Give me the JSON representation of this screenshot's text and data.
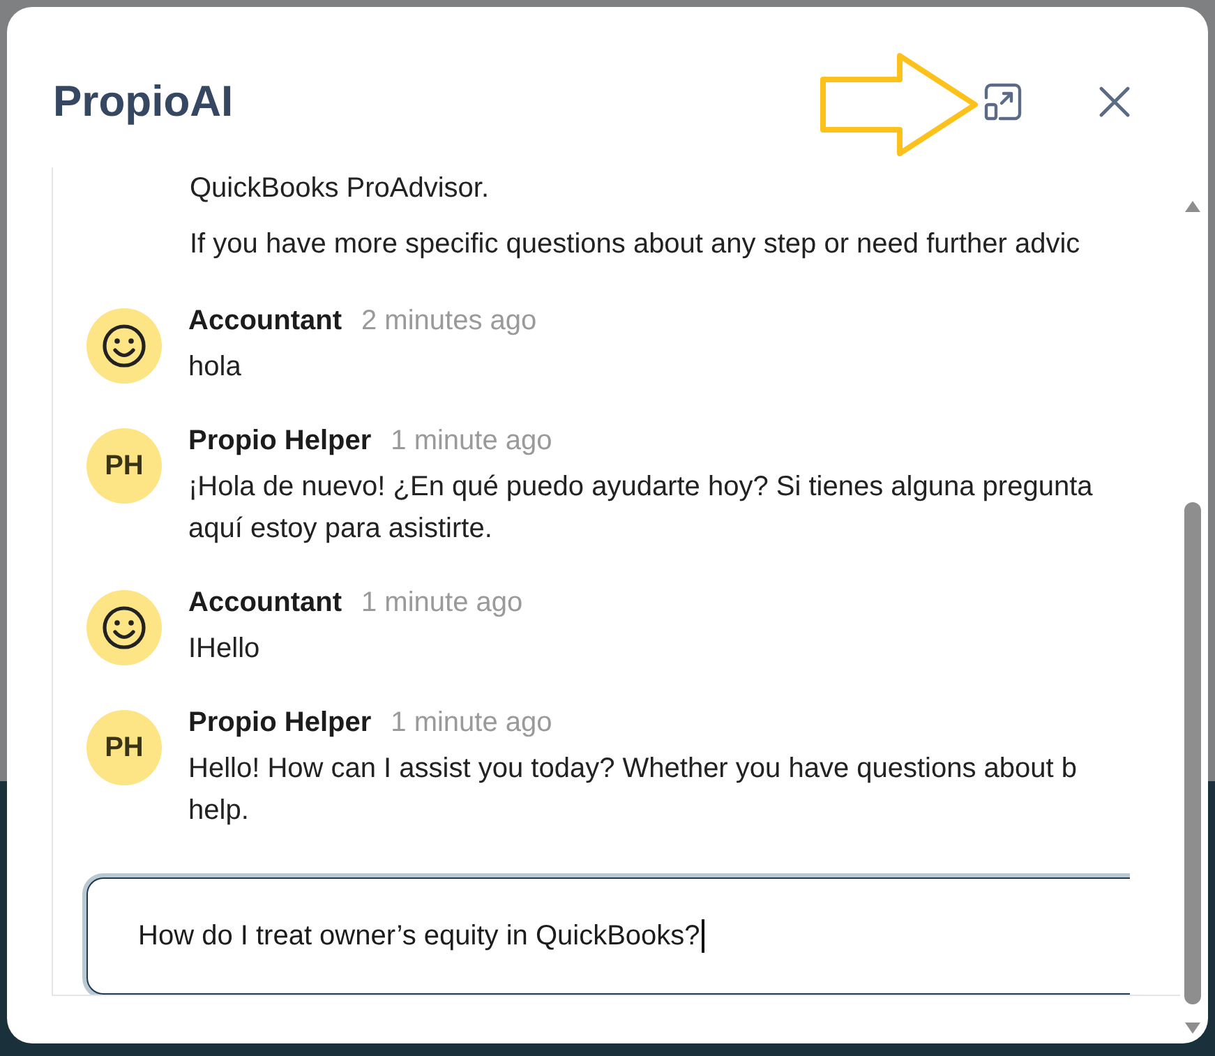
{
  "dialog": {
    "title": "PropioAI"
  },
  "chat": {
    "messages": [
      {
        "kind": "continued",
        "paragraphs": [
          "QuickBooks ProAdvisor.",
          "If you have more specific questions about any step or need further advic"
        ]
      },
      {
        "kind": "message",
        "author": "Accountant",
        "time": "2 minutes ago",
        "avatar": {
          "kind": "smiley"
        },
        "lines": [
          "hola"
        ]
      },
      {
        "kind": "message",
        "author": "Propio Helper",
        "time": "1 minute ago",
        "avatar": {
          "kind": "initials",
          "text": "PH"
        },
        "lines": [
          "¡Hola de nuevo! ¿En qué puedo ayudarte hoy? Si tienes alguna pregunta",
          "aquí estoy para asistirte."
        ]
      },
      {
        "kind": "message",
        "author": "Accountant",
        "time": "1 minute ago",
        "avatar": {
          "kind": "smiley"
        },
        "lines": [
          "IHello"
        ]
      },
      {
        "kind": "message",
        "author": "Propio Helper",
        "time": "1 minute ago",
        "avatar": {
          "kind": "initials",
          "text": "PH"
        },
        "lines": [
          "Hello! How can I assist you today? Whether you have questions about b",
          "help."
        ]
      }
    ]
  },
  "composer": {
    "value": "How do I treat owner’s equity in QuickBooks?"
  }
}
